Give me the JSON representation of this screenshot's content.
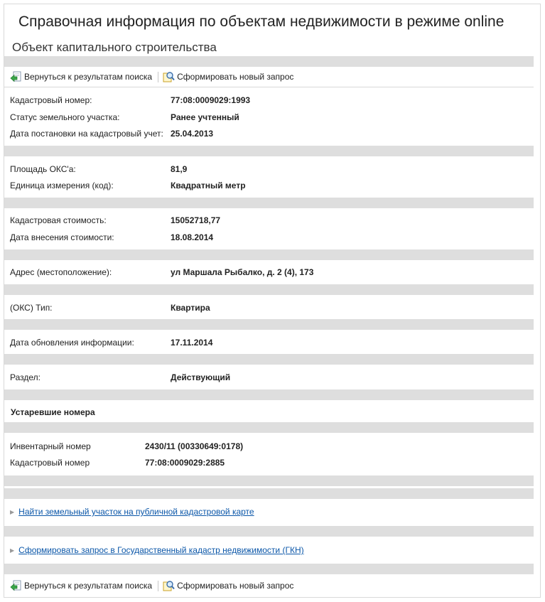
{
  "header": {
    "title": "Справочная информация по объектам недвижимости в режиме online",
    "subtitle": "Объект капитального строительства"
  },
  "toolbar": {
    "back_label": "Вернуться к результатам поиска",
    "new_request_label": "Сформировать новый запрос"
  },
  "info": {
    "cadastral_number": {
      "label": "Кадастровый номер:",
      "value": "77:08:0009029:1993"
    },
    "land_status": {
      "label": "Статус земельного участка:",
      "value": "Ранее учтенный"
    },
    "registration_date": {
      "label": "Дата постановки на кадастровый учет:",
      "value": "25.04.2013"
    },
    "area": {
      "label": "Площадь ОКС'а:",
      "value": "81,9"
    },
    "unit": {
      "label": "Единица измерения (код):",
      "value": "Квадратный метр"
    },
    "cost": {
      "label": "Кадастровая стоимость:",
      "value": "15052718,77"
    },
    "cost_date": {
      "label": "Дата внесения стоимости:",
      "value": "18.08.2014"
    },
    "address": {
      "label": "Адрес (местоположение):",
      "value": "ул Маршала Рыбалко, д. 2 (4), 173"
    },
    "type": {
      "label": "(ОКС) Тип:",
      "value": "Квартира"
    },
    "update_date": {
      "label": "Дата обновления информации:",
      "value": "17.11.2014"
    },
    "section": {
      "label": "Раздел:",
      "value": "Действующий"
    }
  },
  "obsolete": {
    "title": "Устаревшие номера",
    "inventory": {
      "label": "Инвентарный номер",
      "value": "2430/11 (00330649:0178)"
    },
    "cadastral": {
      "label": "Кадастровый номер",
      "value": "77:08:0009029:2885"
    }
  },
  "links": {
    "map": "Найти земельный участок на публичной кадастровой карте",
    "gkn": "Сформировать запрос в Государственный кадастр недвижимости (ГКН)"
  },
  "colors": {
    "band": "#dedede",
    "link": "#0a56a8",
    "border": "#d9d9d9"
  },
  "icons": {
    "back": "back-arrow-document-icon",
    "new_request": "magnifier-document-icon",
    "link_arrow": "triangle-right-icon"
  }
}
